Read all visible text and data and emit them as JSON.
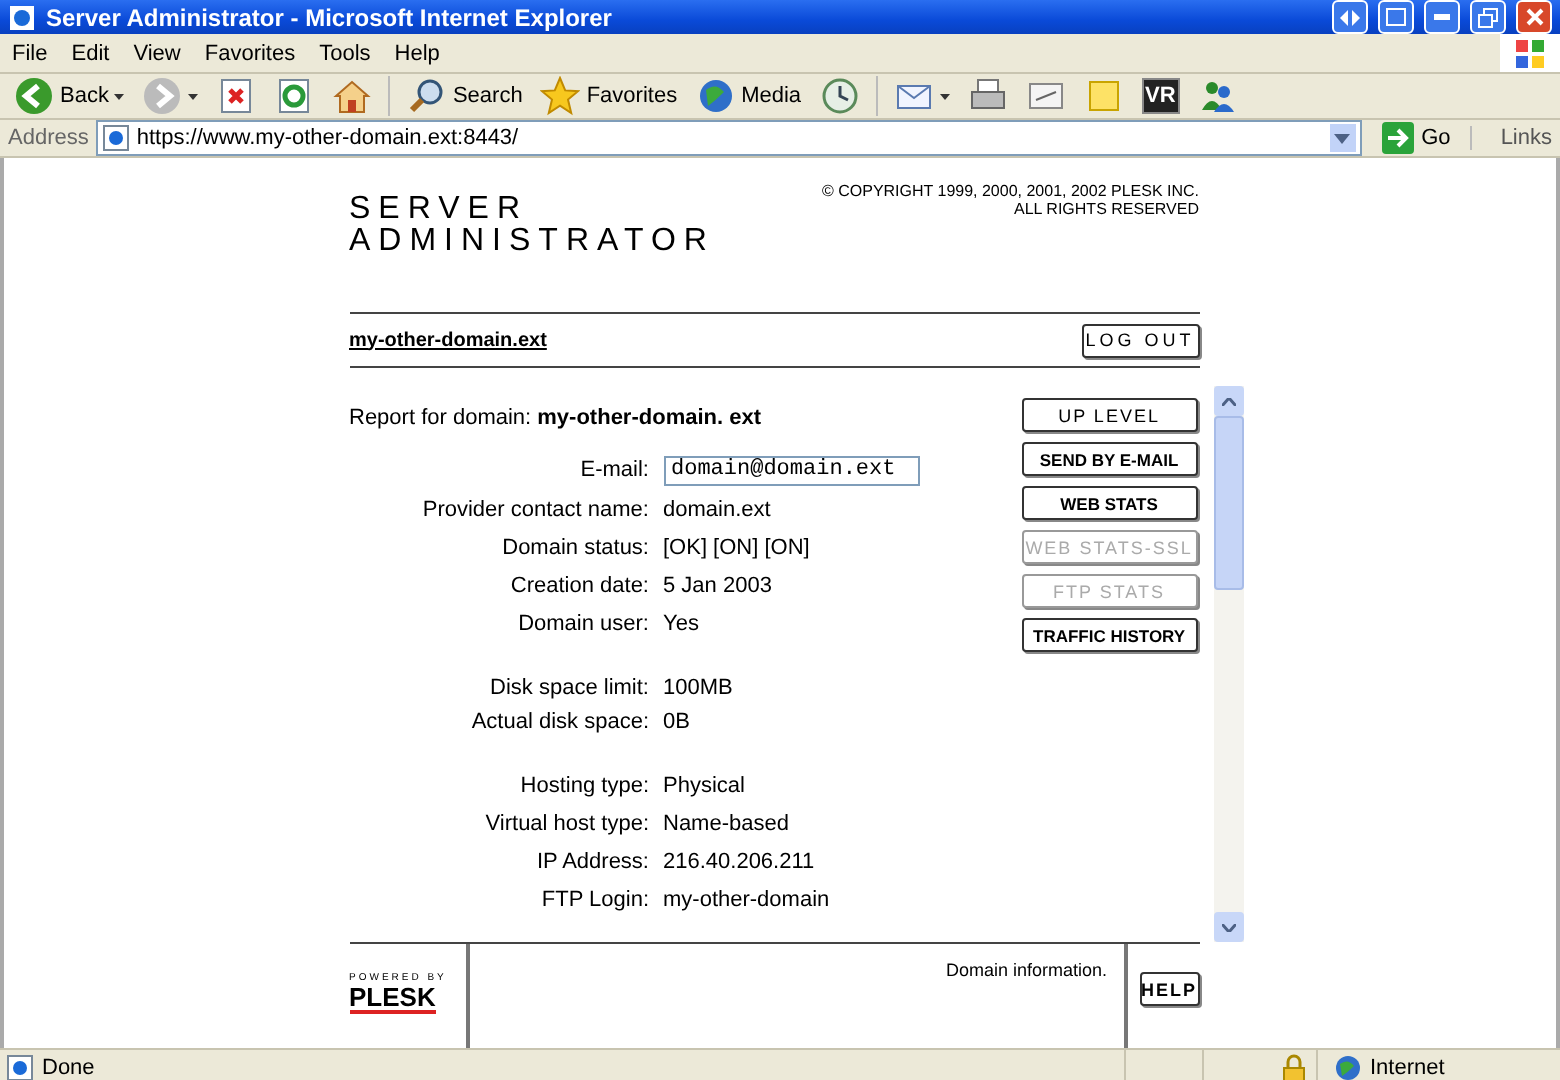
{
  "window": {
    "title": "Server Administrator - Microsoft Internet Explorer"
  },
  "menu": [
    "File",
    "Edit",
    "View",
    "Favorites",
    "Tools",
    "Help"
  ],
  "toolbar": [
    {
      "kind": "back",
      "label": "Back"
    },
    {
      "kind": "forward"
    },
    {
      "kind": "stop"
    },
    {
      "kind": "refresh"
    },
    {
      "kind": "home"
    },
    {
      "kind": "search",
      "label": "Search"
    },
    {
      "kind": "favorites",
      "label": "Favorites"
    },
    {
      "kind": "media",
      "label": "Media"
    },
    {
      "kind": "history"
    },
    {
      "kind": "mail"
    },
    {
      "kind": "print"
    },
    {
      "kind": "edit"
    },
    {
      "kind": "note"
    },
    {
      "kind": "vr",
      "label": "VR"
    },
    {
      "kind": "messenger"
    }
  ],
  "address_bar": {
    "label": "Address",
    "url": "https://www.my-other-domain.ext:8443/",
    "go": "Go",
    "links": "Links"
  },
  "page": {
    "logo": [
      "SERVER",
      "ADMINISTRATOR"
    ],
    "copyright": [
      "© COPYRIGHT 1999, 2000, 2001, 2002 PLESK INC.",
      "ALL RIGHTS RESERVED"
    ],
    "domain_link": "my-other-domain.ext",
    "logout": "LOG OUT",
    "report": "Report for domain: **my-other-domain. ext**",
    "field_groups": [
      [
        {
          "kind": "input",
          "label": "E-mail:",
          "value": "domain@domain.ext"
        },
        {
          "kind": "text",
          "label": "Provider contact name:",
          "value": "domain.ext"
        },
        {
          "kind": "text",
          "label": "Domain status:",
          "value": "[OK] [ON] [ON]"
        },
        {
          "kind": "text",
          "label": "Creation date:",
          "value": "5 Jan 2003"
        },
        {
          "kind": "text",
          "label": "Domain user:",
          "value": "Yes"
        }
      ],
      [
        {
          "kind": "text",
          "label": "Disk space limit:",
          "value": "100MB"
        },
        {
          "kind": "text",
          "label": "Actual disk space:",
          "value": "0B"
        }
      ],
      [
        {
          "kind": "text",
          "label": "Hosting type:",
          "value": "Physical"
        },
        {
          "kind": "text",
          "label": "Virtual host type:",
          "value": "Name-based"
        },
        {
          "kind": "text",
          "label": "IP Address:",
          "value": "216.40.206.211"
        },
        {
          "kind": "text",
          "label": "FTP Login:",
          "value": "my-other-domain"
        }
      ]
    ],
    "buttons": [
      {
        "label": "UP LEVEL",
        "disabled": false
      },
      {
        "label": "SEND BY E-MAIL",
        "disabled": false
      },
      {
        "label": "WEB STATS",
        "disabled": false
      },
      {
        "label": "WEB STATS-SSL",
        "disabled": true
      },
      {
        "label": "FTP STATS",
        "disabled": true
      },
      {
        "label": "TRAFFIC HISTORY",
        "disabled": false
      }
    ],
    "footer": {
      "powered_by": "POWERED BY",
      "brand": "PLESK",
      "description": "Domain information.",
      "help": "HELP"
    }
  },
  "status_bar": {
    "text": "Done",
    "zone": "Internet"
  }
}
